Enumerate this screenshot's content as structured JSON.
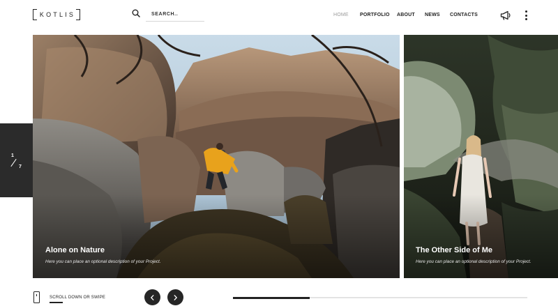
{
  "brand": {
    "logo_text": "KOTLIS"
  },
  "search": {
    "placeholder": "SEARCH.."
  },
  "nav": {
    "items": [
      {
        "label": "HOME",
        "active": true
      },
      {
        "label": "PORTFOLIO",
        "active": false
      },
      {
        "label": "ABOUT",
        "active": false
      },
      {
        "label": "NEWS",
        "active": false
      },
      {
        "label": "CONTACTS",
        "active": false
      }
    ]
  },
  "header_icons": [
    "search-icon",
    "megaphone-icon",
    "kebab-menu-icon"
  ],
  "counter": {
    "current": "1",
    "total": "7"
  },
  "slides": [
    {
      "title": "Alone on Nature",
      "description": "Here you can place an optional description of your Project."
    },
    {
      "title": "The Other Side of Me",
      "description": "Here you can place an optional description of your Project."
    }
  ],
  "footer": {
    "scroll_hint": "SCROLL DOWN OR SWIPE",
    "progress_fraction": 0.26
  },
  "colors": {
    "text": "#222222",
    "muted": "#9a9a9a",
    "dark_panel": "#2b2b2b",
    "accent_jacket": "#e8a21c"
  }
}
